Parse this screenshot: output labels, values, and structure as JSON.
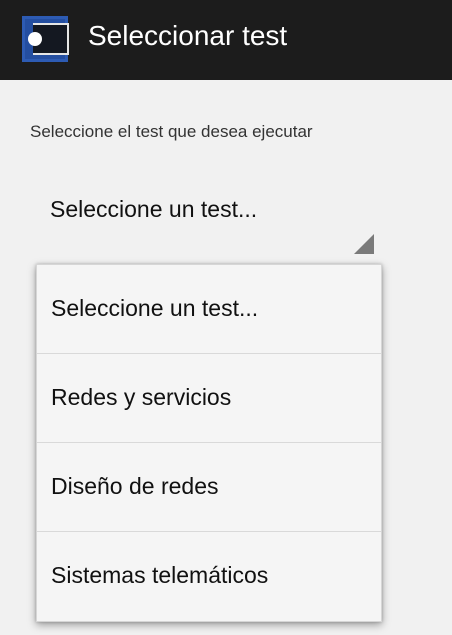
{
  "app_bar": {
    "title": "Seleccionar test",
    "icon": "app-window-icon"
  },
  "main": {
    "instruction": "Seleccione el test que desea ejecutar",
    "spinner": {
      "selected_value": "Seleccione un test...",
      "arrow_icon": "dropdown-triangle-icon"
    }
  },
  "dropdown": {
    "items": [
      {
        "label": "Seleccione un test..."
      },
      {
        "label": "Redes y servicios"
      },
      {
        "label": "Diseño de redes"
      },
      {
        "label": "Sistemas telemáticos"
      }
    ]
  },
  "colors": {
    "app_bar_bg": "#1c1c1c",
    "background": "#f1f1f1",
    "popup_bg": "#f5f5f5",
    "icon_blue": "#244ea0"
  }
}
